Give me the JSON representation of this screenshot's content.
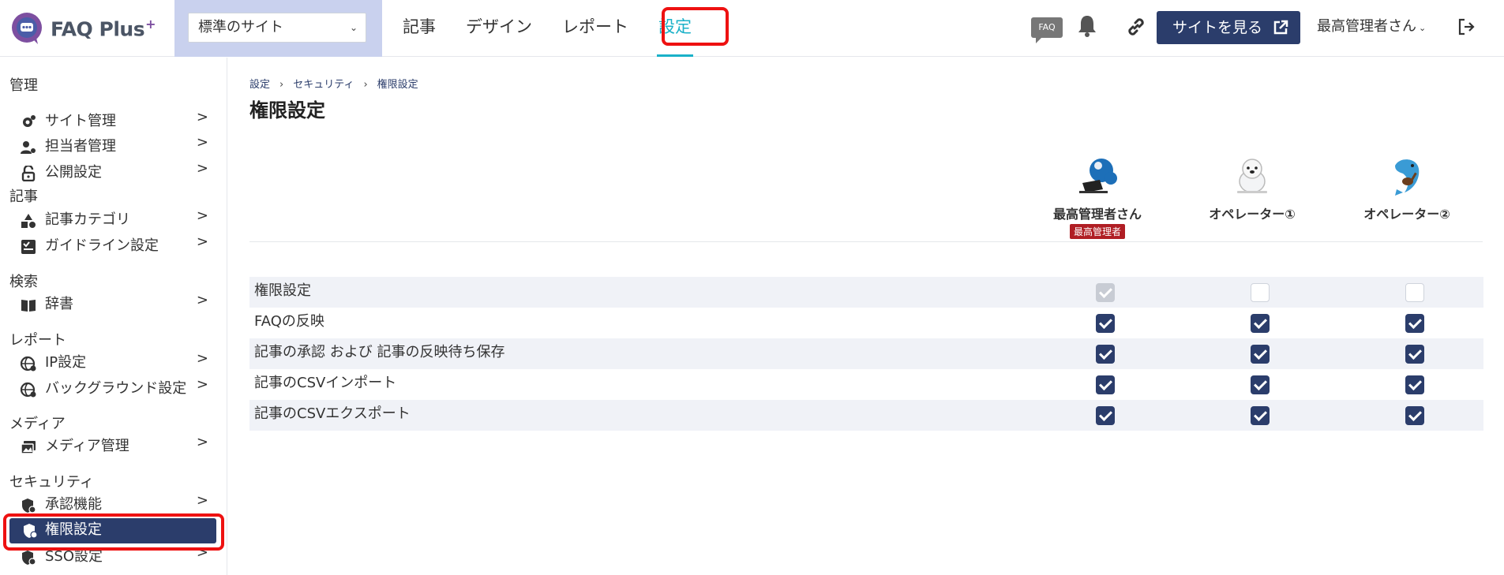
{
  "app": {
    "logo_main": "FAQ Plus",
    "logo_plus": "+"
  },
  "site_select": {
    "value": "標準のサイト"
  },
  "nav": {
    "items": [
      {
        "label": "記事"
      },
      {
        "label": "デザイン"
      },
      {
        "label": "レポート"
      },
      {
        "label": "設定",
        "active": true
      }
    ]
  },
  "header": {
    "faq_badge": "FAQ",
    "view_site_label": "サイトを見る",
    "user_name": "最高管理者さん"
  },
  "sidebar": {
    "sections": [
      {
        "title": "管理",
        "items": [
          "サイト管理",
          "担当者管理",
          "公開設定"
        ]
      },
      {
        "title": "記事",
        "items": [
          "記事カテゴリ",
          "ガイドライン設定"
        ]
      },
      {
        "title": "検索",
        "items": [
          "辞書"
        ]
      },
      {
        "title": "レポート",
        "items": [
          "IP設定",
          "バックグラウンド設定"
        ]
      },
      {
        "title": "メディア",
        "items": [
          "メディア管理"
        ]
      },
      {
        "title": "セキュリティ",
        "items": [
          "承認機能",
          "権限設定",
          "SSO設定"
        ]
      }
    ],
    "arrow": ">"
  },
  "breadcrumb": [
    "設定",
    "セキュリティ",
    "権限設定"
  ],
  "breadcrumb_sep": "›",
  "page_title": "権限設定",
  "users": [
    {
      "name": "最高管理者さん",
      "role": "最高管理者"
    },
    {
      "name": "オペレーター①"
    },
    {
      "name": "オペレーター②"
    }
  ],
  "permissions": [
    {
      "label": "権限設定",
      "values": [
        "disabled-checked",
        "unchecked",
        "unchecked"
      ]
    },
    {
      "label": "FAQの反映",
      "values": [
        "checked",
        "checked",
        "checked"
      ]
    },
    {
      "label": "記事の承認 および 記事の反映待ち保存",
      "values": [
        "checked",
        "checked",
        "checked"
      ]
    },
    {
      "label": "記事のCSVインポート",
      "values": [
        "checked",
        "checked",
        "checked"
      ]
    },
    {
      "label": "記事のCSVエクスポート",
      "values": [
        "checked",
        "checked",
        "checked"
      ]
    }
  ],
  "colors": {
    "primary": "#2b3d6b",
    "accent": "#1ab1c8",
    "highlight": "#e11111",
    "role_badge": "#b01e24"
  }
}
